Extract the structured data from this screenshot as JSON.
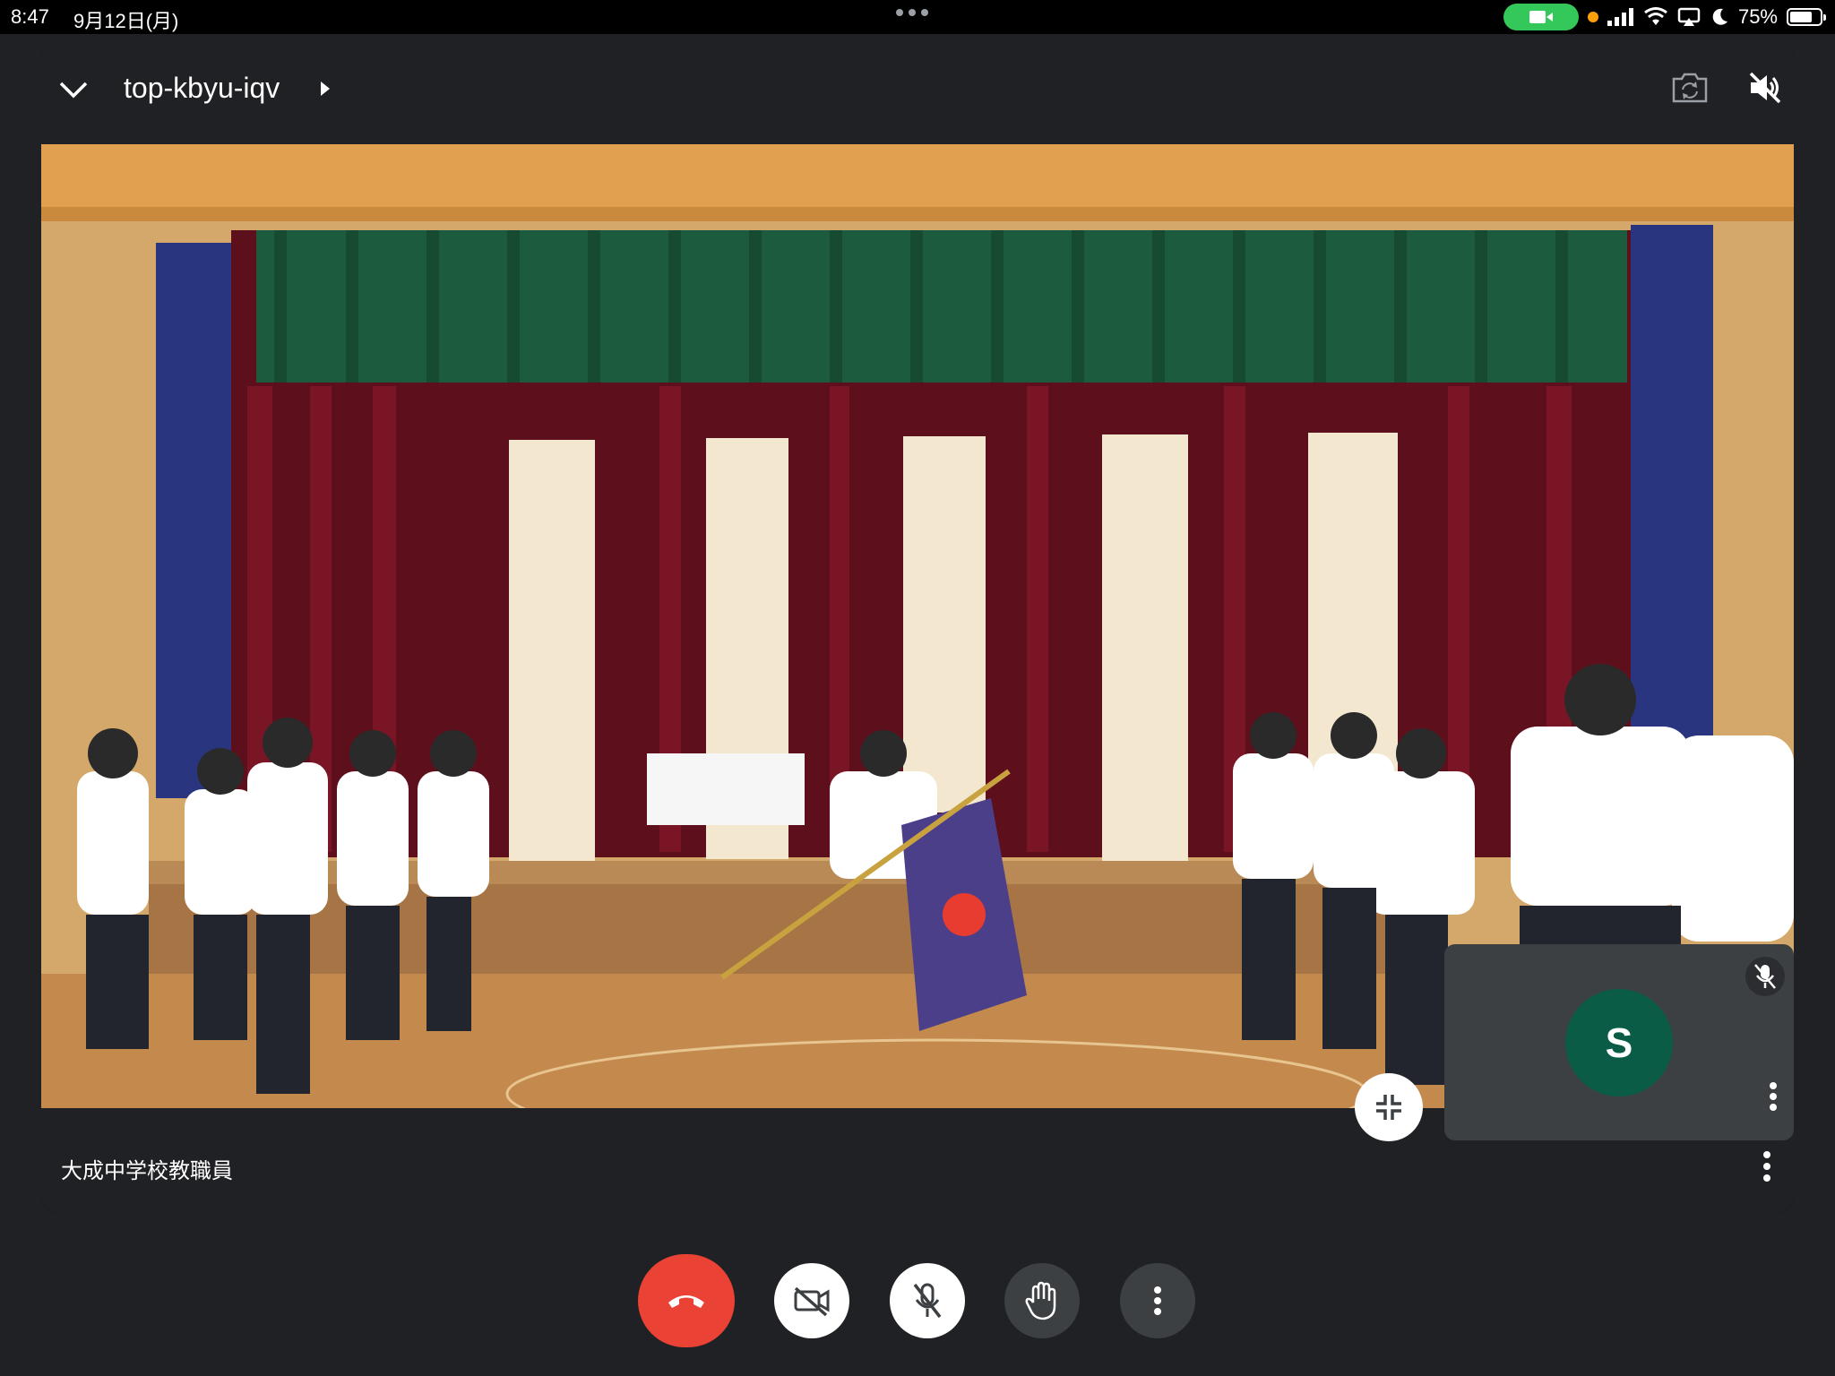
{
  "status_bar": {
    "time": "8:47",
    "date": "9月12日(月)",
    "battery_percent": "75%",
    "battery_level": 0.75
  },
  "meeting": {
    "code": "top-kbyu-iqv",
    "participant_name": "大成中学校教職員"
  },
  "self_tile": {
    "initial": "S",
    "avatar_color": "#0b5c47"
  },
  "colors": {
    "end_call": "#ea4335",
    "tile_bg": "#3c4043",
    "camera_pill": "#34c759"
  },
  "icons": {
    "back": "chevron-down-icon",
    "flip_camera": "flip-camera-icon",
    "speaker": "speaker-off-icon",
    "end_call": "phone-hangup-icon",
    "camera": "camera-off-icon",
    "mic": "mic-off-icon",
    "hand": "raise-hand-icon",
    "more": "more-vert-icon",
    "shrink": "shrink-icon"
  }
}
